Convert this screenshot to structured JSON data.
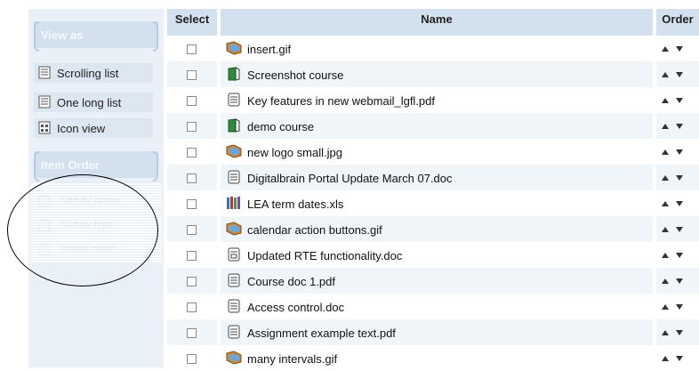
{
  "sidebar": {
    "view_as": {
      "title": "View as",
      "items": [
        {
          "label": "Scrolling list",
          "icon": "scrolling-list-icon"
        },
        {
          "label": "One long list",
          "icon": "one-long-list-icon"
        },
        {
          "label": "Icon view",
          "icon": "icon-view-icon"
        }
      ]
    },
    "item_order": {
      "title": "Item Order",
      "items": [
        {
          "label": "Sort by Name",
          "icon": "sort-by-name-icon"
        },
        {
          "label": "Sort by type",
          "icon": "sort-by-type-icon"
        },
        {
          "label": "Preset order",
          "icon": "preset-order-icon"
        }
      ]
    }
  },
  "table": {
    "headers": {
      "select": "Select",
      "name": "Name",
      "order": "Order"
    },
    "rows": [
      {
        "name": "insert.gif",
        "type": "image"
      },
      {
        "name": "Screenshot course",
        "type": "course"
      },
      {
        "name": "Key features in new webmail_lgfl.pdf",
        "type": "document"
      },
      {
        "name": "demo course",
        "type": "course"
      },
      {
        "name": "new logo small.jpg",
        "type": "image"
      },
      {
        "name": "Digitalbrain Portal Update March 07.doc",
        "type": "document"
      },
      {
        "name": "LEA term dates.xls",
        "type": "spreadsheet"
      },
      {
        "name": "calendar action buttons.gif",
        "type": "image"
      },
      {
        "name": "Updated RTE functionality.doc",
        "type": "link-document"
      },
      {
        "name": "Course doc 1.pdf",
        "type": "document"
      },
      {
        "name": "Access control.doc",
        "type": "document"
      },
      {
        "name": "Assignment example text.pdf",
        "type": "document"
      },
      {
        "name": "many intervals.gif",
        "type": "image"
      }
    ]
  },
  "colors": {
    "sidebar_bg": "#e9f0f7",
    "header_bg": "#d3e0ee",
    "accent_green": "#2e8b3a",
    "image_icon": "#c07a2c"
  }
}
